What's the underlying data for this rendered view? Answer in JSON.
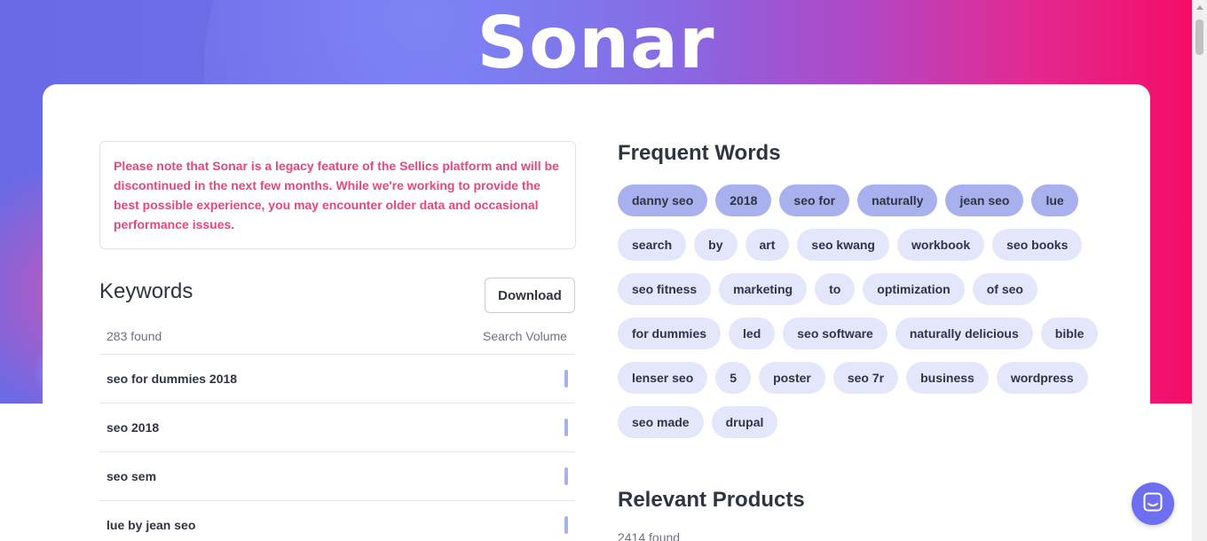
{
  "app": {
    "title": "Sonar"
  },
  "notice": {
    "text": "Please note that Sonar is a legacy feature of the Sellics platform and will be discontinued in the next few months. While we're working to provide the best possible experience, you may encounter older data and occasional performance issues."
  },
  "keywords": {
    "title": "Keywords",
    "download_label": "Download",
    "count_label": "283 found",
    "volume_header": "Search Volume",
    "rows": [
      {
        "text": "seo for dummies 2018"
      },
      {
        "text": "seo 2018"
      },
      {
        "text": "seo sem"
      },
      {
        "text": "lue by jean seo"
      }
    ]
  },
  "frequent_words": {
    "title": "Frequent Words",
    "chips": [
      {
        "label": "danny seo",
        "highlighted": true
      },
      {
        "label": "2018",
        "highlighted": true
      },
      {
        "label": "seo for",
        "highlighted": true
      },
      {
        "label": "naturally",
        "highlighted": true
      },
      {
        "label": "jean seo",
        "highlighted": true
      },
      {
        "label": "lue",
        "highlighted": true
      },
      {
        "label": "search",
        "highlighted": false
      },
      {
        "label": "by",
        "highlighted": false
      },
      {
        "label": "art",
        "highlighted": false
      },
      {
        "label": "seo kwang",
        "highlighted": false
      },
      {
        "label": "workbook",
        "highlighted": false
      },
      {
        "label": "seo books",
        "highlighted": false
      },
      {
        "label": "seo fitness",
        "highlighted": false
      },
      {
        "label": "marketing",
        "highlighted": false
      },
      {
        "label": "to",
        "highlighted": false
      },
      {
        "label": "optimization",
        "highlighted": false
      },
      {
        "label": "of seo",
        "highlighted": false
      },
      {
        "label": "for dummies",
        "highlighted": false
      },
      {
        "label": "led",
        "highlighted": false
      },
      {
        "label": "seo software",
        "highlighted": false
      },
      {
        "label": "naturally delicious",
        "highlighted": false
      },
      {
        "label": "bible",
        "highlighted": false
      },
      {
        "label": "lenser seo",
        "highlighted": false
      },
      {
        "label": "5",
        "highlighted": false
      },
      {
        "label": "poster",
        "highlighted": false
      },
      {
        "label": "seo 7r",
        "highlighted": false
      },
      {
        "label": "business",
        "highlighted": false
      },
      {
        "label": "wordpress",
        "highlighted": false
      },
      {
        "label": "seo made",
        "highlighted": false
      },
      {
        "label": "drupal",
        "highlighted": false
      }
    ]
  },
  "relevant_products": {
    "title": "Relevant Products",
    "count_label": "2414 found"
  },
  "colors": {
    "accent": "#6e6ef0",
    "notice_text": "#e8467c",
    "chip_highlight": "#a9b0ee",
    "chip_default": "#e4e7fb"
  },
  "icons": {
    "chat": "chat-bubble-icon",
    "scroll_up": "chevron-up-icon"
  }
}
